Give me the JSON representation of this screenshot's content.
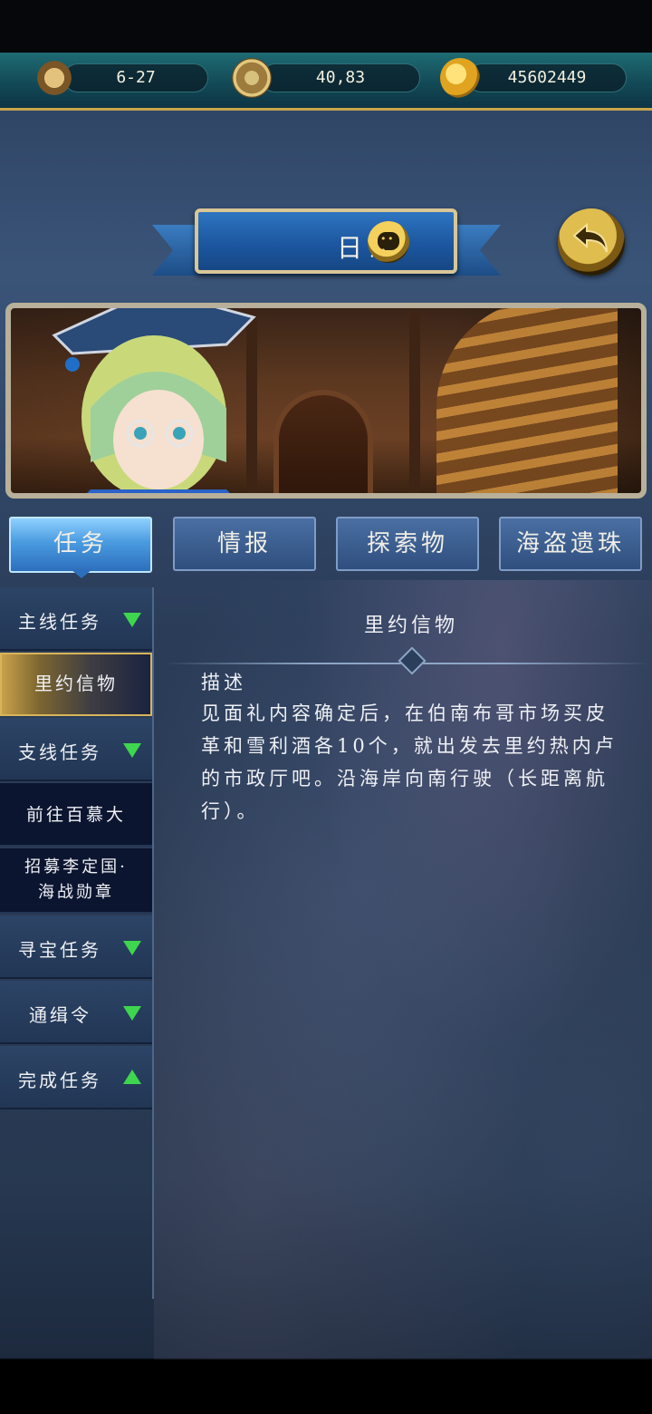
{
  "resources": [
    {
      "icon": "hourglass-icon",
      "value": "6-27"
    },
    {
      "icon": "compass-icon",
      "value": "40,83"
    },
    {
      "icon": "gold-coin-icon",
      "value": "45602449"
    }
  ],
  "header": {
    "title": "日志",
    "title_icon": "chat-bubble-icon",
    "back_icon": "back-arrow-icon"
  },
  "tabs": [
    {
      "label": "任务",
      "active": true
    },
    {
      "label": "情报",
      "active": false
    },
    {
      "label": "探索物",
      "active": false
    },
    {
      "label": "海盗遗珠",
      "active": false
    }
  ],
  "sidebar": {
    "items": [
      {
        "label": "主线任务",
        "expand": "collapsed"
      },
      {
        "label": "里约信物",
        "sub": true,
        "selected": true
      },
      {
        "label": "支线任务",
        "expand": "collapsed"
      },
      {
        "label": "前往百慕大",
        "sub": true,
        "selected": false
      },
      {
        "label": "招募李定国·",
        "label2": "海战勋章",
        "sub": true,
        "selected": false
      },
      {
        "label": "寻宝任务",
        "expand": "collapsed"
      },
      {
        "label": "通缉令",
        "expand": "collapsed"
      },
      {
        "label": "完成任务",
        "expand": "expanded"
      }
    ]
  },
  "detail": {
    "title": "里约信物",
    "heading": "描述",
    "body": "见面礼内容确定后，在伯南布哥市场买皮革和雪利酒各10个，就出发去里约热内卢的市政厅吧。沿海岸向南行驶（长距离航行）。"
  },
  "colors": {
    "accent_green_arrow": "#3ed64f",
    "tab_active": "#4a9be0",
    "gold": "#c8a64f"
  }
}
